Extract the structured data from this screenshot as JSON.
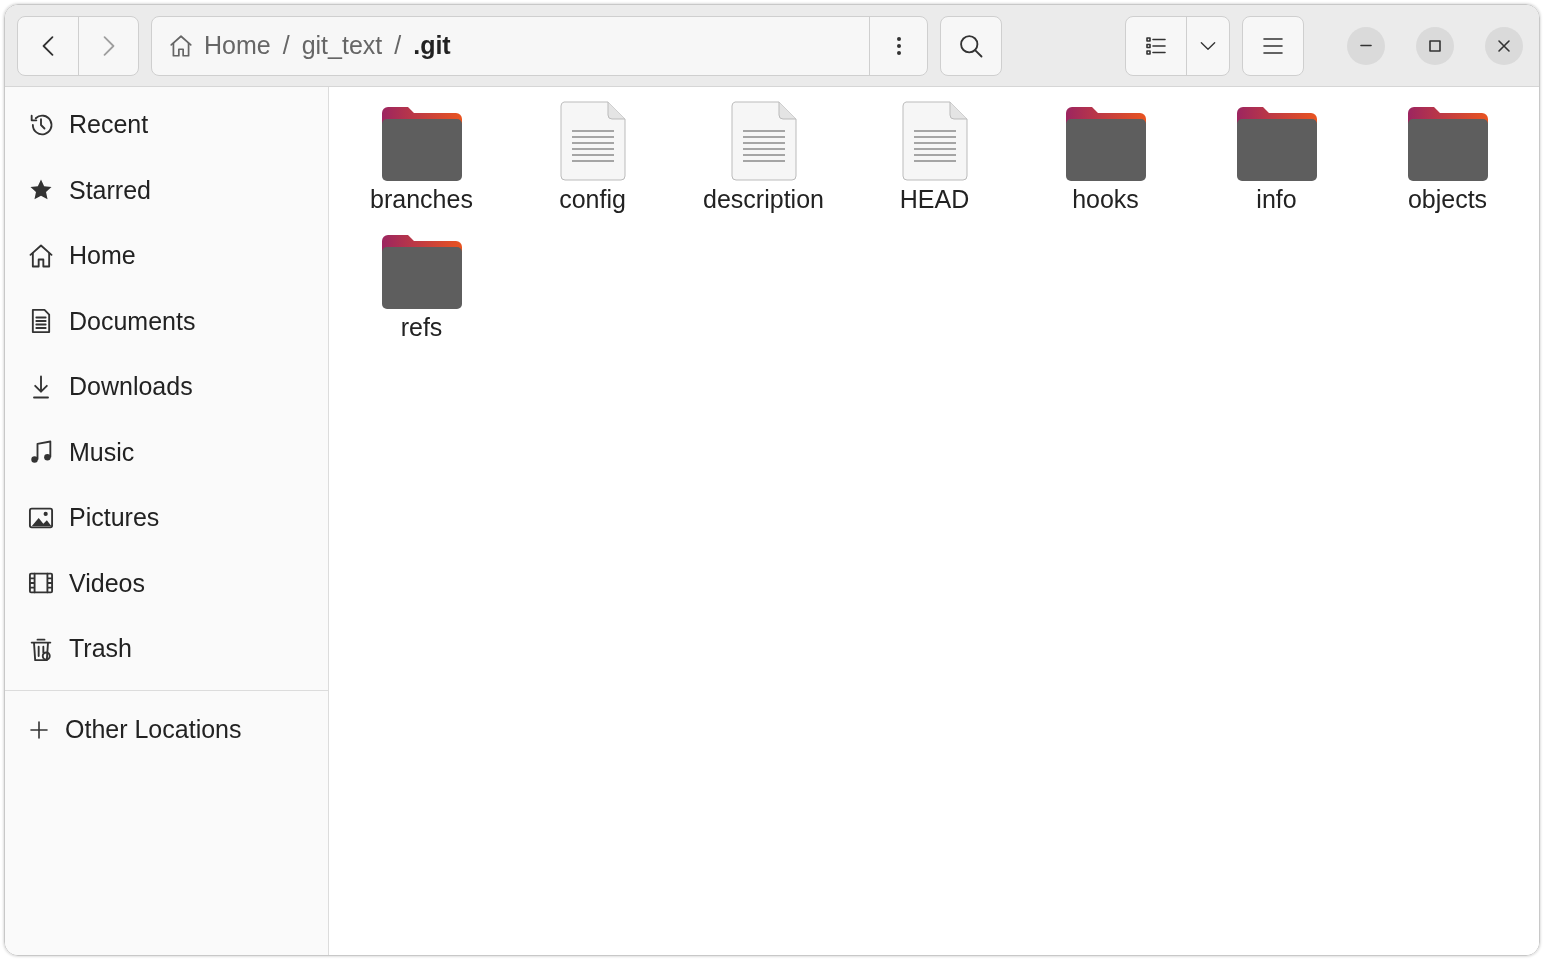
{
  "navigation": {
    "back": {
      "disabled": false
    },
    "forward": {
      "disabled": true
    }
  },
  "path_bar": {
    "crumbs": [
      {
        "label": "Home",
        "kind": "home",
        "selected": false
      },
      {
        "label": "git_text",
        "kind": "folder",
        "selected": false
      },
      {
        "label": ".git",
        "kind": "folder",
        "selected": true
      }
    ],
    "separator": "/"
  },
  "sidebar": {
    "items": [
      {
        "label": "Recent",
        "kind": "recent"
      },
      {
        "label": "Starred",
        "kind": "starred"
      },
      {
        "label": "Home",
        "kind": "home"
      },
      {
        "label": "Documents",
        "kind": "documents"
      },
      {
        "label": "Downloads",
        "kind": "downloads"
      },
      {
        "label": "Music",
        "kind": "music"
      },
      {
        "label": "Pictures",
        "kind": "pictures"
      },
      {
        "label": "Videos",
        "kind": "videos"
      },
      {
        "label": "Trash",
        "kind": "trash"
      }
    ],
    "other": {
      "label": "Other Locations",
      "kind": "add"
    }
  },
  "files": [
    {
      "name": "branches",
      "kind": "folder"
    },
    {
      "name": "config",
      "kind": "file"
    },
    {
      "name": "description",
      "kind": "file"
    },
    {
      "name": "HEAD",
      "kind": "file"
    },
    {
      "name": "hooks",
      "kind": "folder"
    },
    {
      "name": "info",
      "kind": "folder"
    },
    {
      "name": "objects",
      "kind": "folder"
    },
    {
      "name": "refs",
      "kind": "folder"
    }
  ]
}
